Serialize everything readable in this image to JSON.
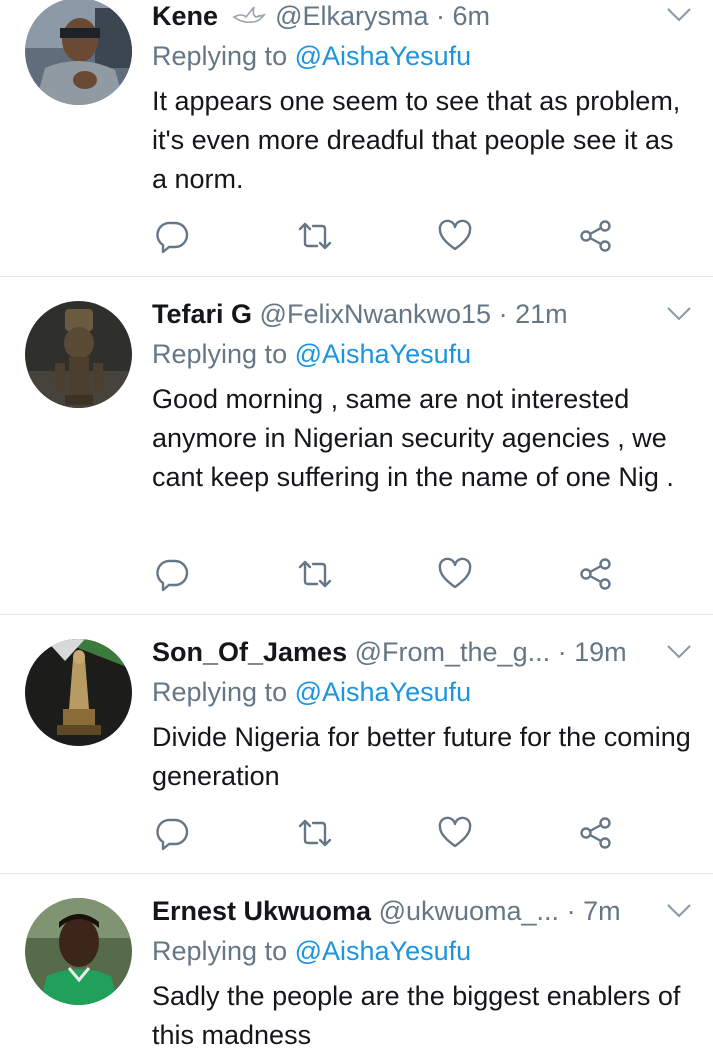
{
  "tweets": [
    {
      "name": "Kene",
      "badge": "dove-icon",
      "handle": "@Elkarysma",
      "time": "6m",
      "reply_prefix": "Replying to",
      "reply_to": "@AishaYesufu",
      "text": "It appears one seem to see that as problem, it's even more dreadful that people see it as a norm."
    },
    {
      "name": "Tefari G",
      "handle": "@FelixNwankwo15",
      "time": "21m",
      "reply_prefix": "Replying to",
      "reply_to": "@AishaYesufu",
      "text": "Good morning , same are not interested anymore in Nigerian security agencies , we cant keep suffering in the name of one Nig ."
    },
    {
      "name": "Son_Of_James",
      "handle": "@From_the_g...",
      "time": "19m",
      "reply_prefix": "Replying to",
      "reply_to": "@AishaYesufu",
      "text": "Divide Nigeria for better future for the coming generation"
    },
    {
      "name": "Ernest Ukwuoma",
      "handle": "@ukwuoma_...",
      "time": "7m",
      "reply_prefix": "Replying to",
      "reply_to": "@AishaYesufu",
      "text": "Sadly the people are the biggest enablers of this madness"
    }
  ],
  "icons": {
    "reply": "reply-icon",
    "retweet": "retweet-icon",
    "like": "heart-icon",
    "share": "share-icon",
    "more": "chevron-down-icon"
  },
  "colors": {
    "text": "#14171a",
    "muted": "#657786",
    "link": "#1b95e0",
    "divider": "#e1e8ed"
  }
}
